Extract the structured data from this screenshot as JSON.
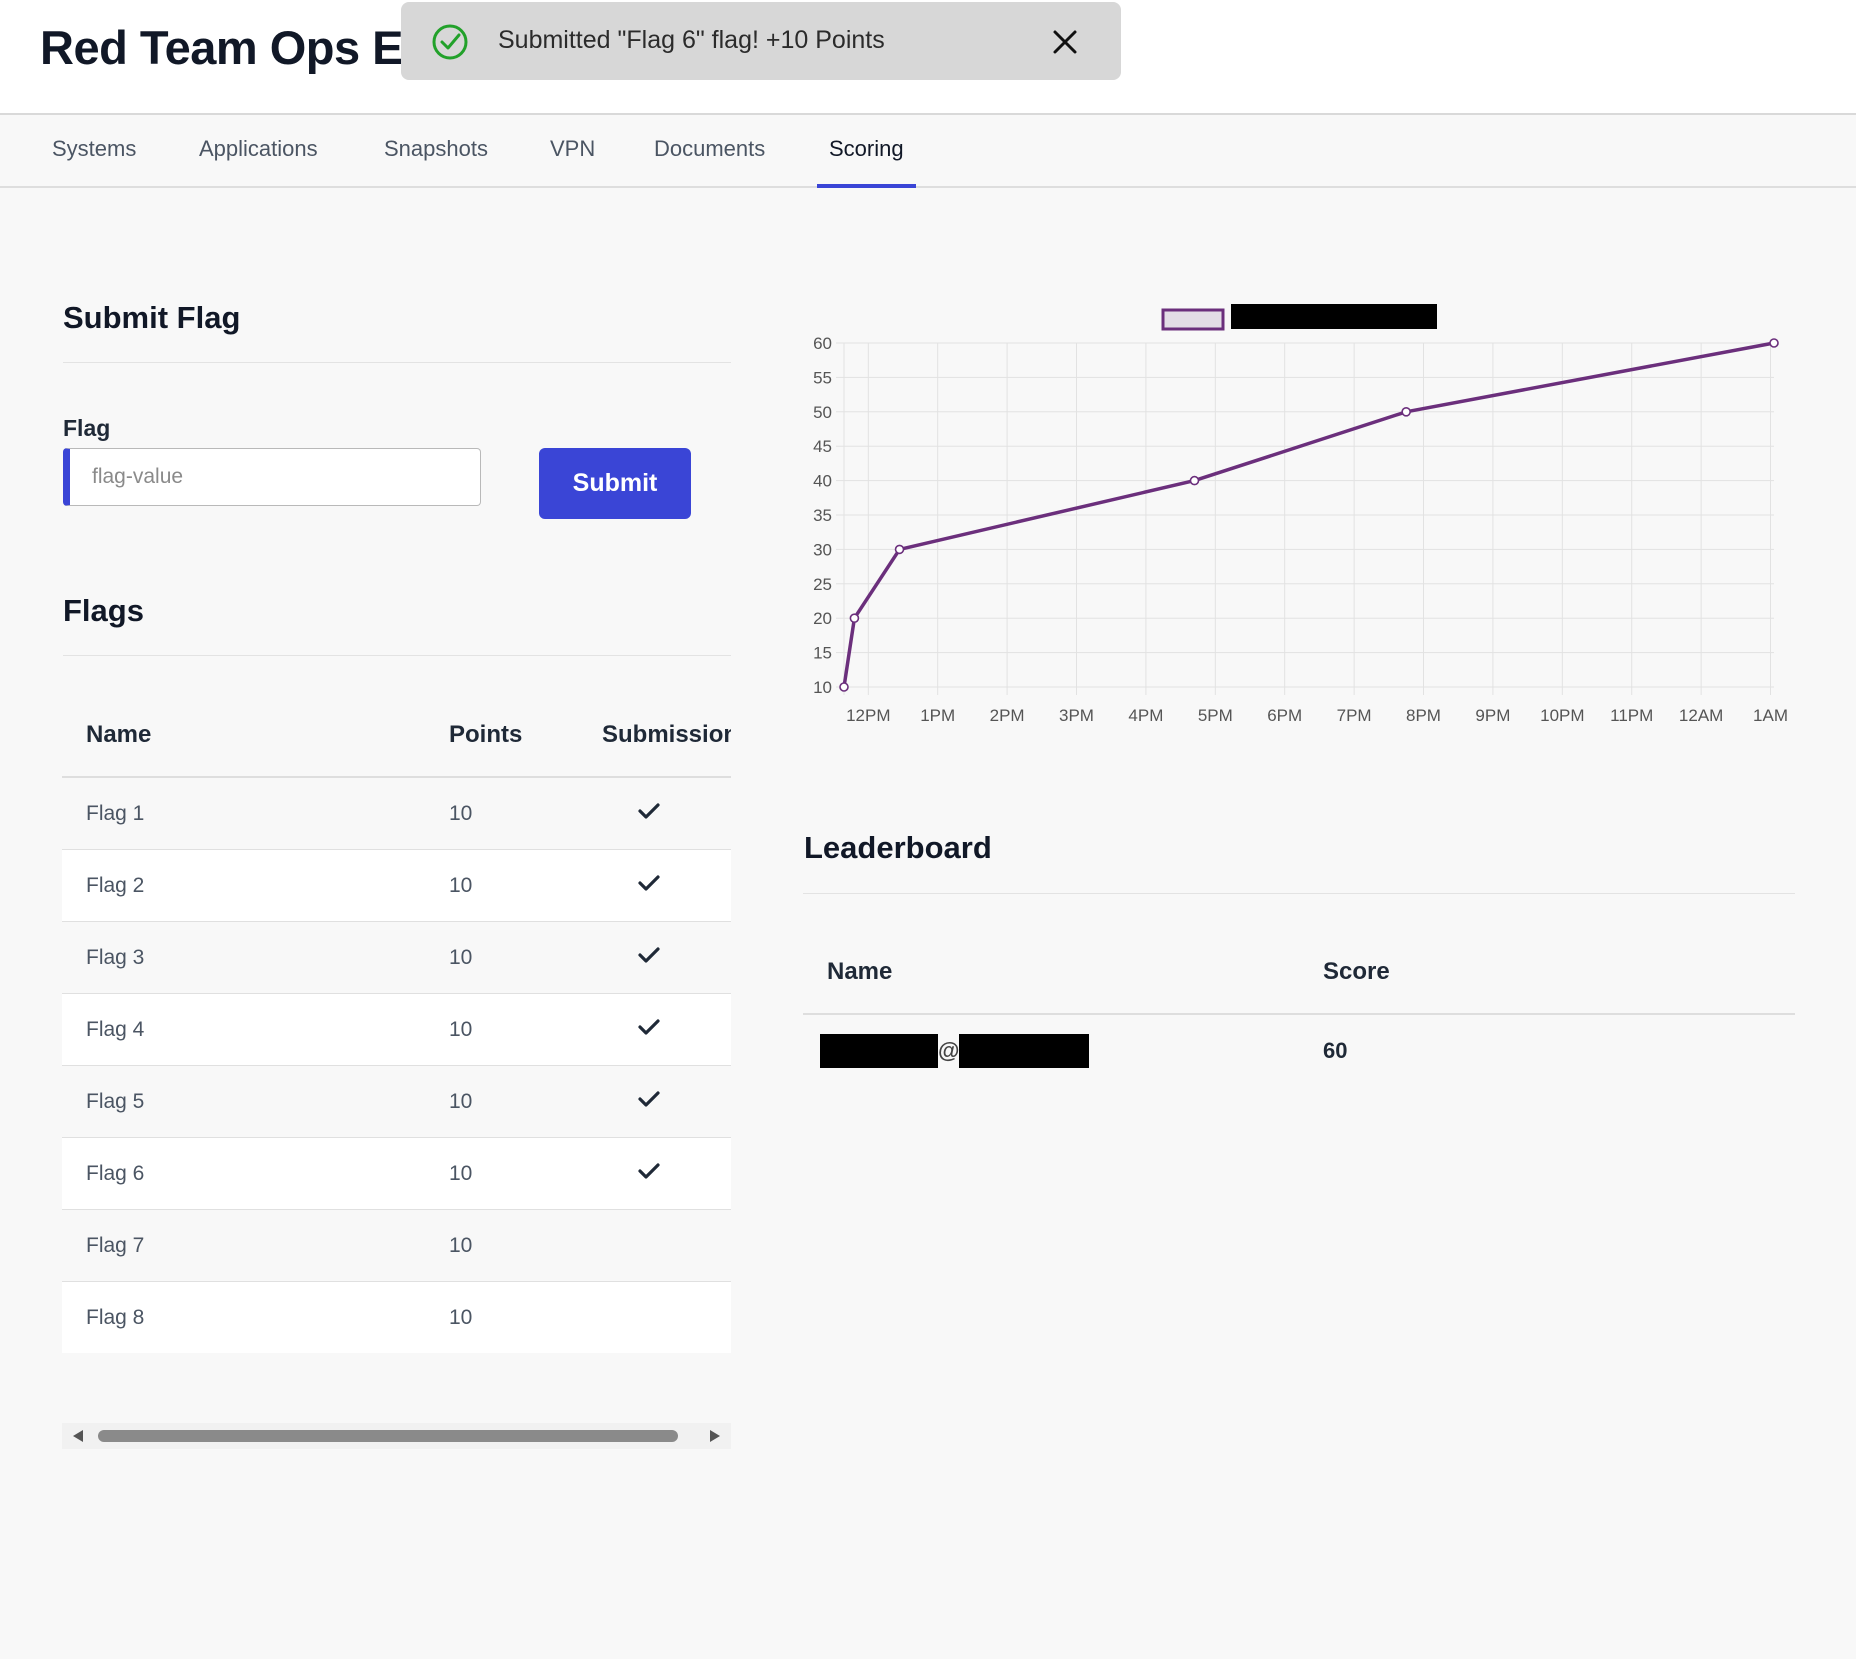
{
  "header": {
    "title": "Red Team Ops Exa"
  },
  "toast": {
    "message": "Submitted \"Flag 6\" flag! +10 Points",
    "status_color": "#22a12a"
  },
  "tabs": [
    {
      "label": "Systems",
      "active": false
    },
    {
      "label": "Applications",
      "active": false
    },
    {
      "label": "Snapshots",
      "active": false
    },
    {
      "label": "VPN",
      "active": false
    },
    {
      "label": "Documents",
      "active": false
    },
    {
      "label": "Scoring",
      "active": true
    }
  ],
  "submit_section": {
    "heading": "Submit Flag",
    "field_label": "Flag",
    "placeholder": "flag-value",
    "button_label": "Submit"
  },
  "flags_section": {
    "heading": "Flags",
    "columns": [
      "Name",
      "Points",
      "Submission"
    ],
    "rows": [
      {
        "name": "Flag 1",
        "points": "10",
        "submitted": true
      },
      {
        "name": "Flag 2",
        "points": "10",
        "submitted": true
      },
      {
        "name": "Flag 3",
        "points": "10",
        "submitted": true
      },
      {
        "name": "Flag 4",
        "points": "10",
        "submitted": true
      },
      {
        "name": "Flag 5",
        "points": "10",
        "submitted": true
      },
      {
        "name": "Flag 6",
        "points": "10",
        "submitted": true
      },
      {
        "name": "Flag 7",
        "points": "10",
        "submitted": false
      },
      {
        "name": "Flag 8",
        "points": "10",
        "submitted": false
      }
    ]
  },
  "leaderboard": {
    "heading": "Leaderboard",
    "columns": [
      "Name",
      "Score"
    ],
    "rows": [
      {
        "name_separator": "@",
        "score": "60"
      }
    ]
  },
  "colors": {
    "accent": "#3a45d6",
    "series": "#6b2f7c"
  },
  "chart_data": {
    "type": "line",
    "x_ticks": [
      "12PM",
      "1PM",
      "2PM",
      "3PM",
      "4PM",
      "5PM",
      "6PM",
      "7PM",
      "8PM",
      "9PM",
      "10PM",
      "11PM",
      "12AM",
      "1AM"
    ],
    "y_ticks": [
      10,
      15,
      20,
      25,
      30,
      35,
      40,
      45,
      50,
      55,
      60
    ],
    "ylim": [
      10,
      60
    ],
    "x_unit": "hours after 12PM",
    "series": [
      {
        "name": "",
        "legend_redacted": true,
        "color": "#6b2f7c",
        "points": [
          {
            "x": -0.35,
            "y": 10
          },
          {
            "x": -0.2,
            "y": 20
          },
          {
            "x": 0.45,
            "y": 30
          },
          {
            "x": 4.7,
            "y": 40
          },
          {
            "x": 7.75,
            "y": 50
          },
          {
            "x": 13.05,
            "y": 60
          }
        ]
      }
    ],
    "grid": true,
    "legend": "top-center"
  }
}
